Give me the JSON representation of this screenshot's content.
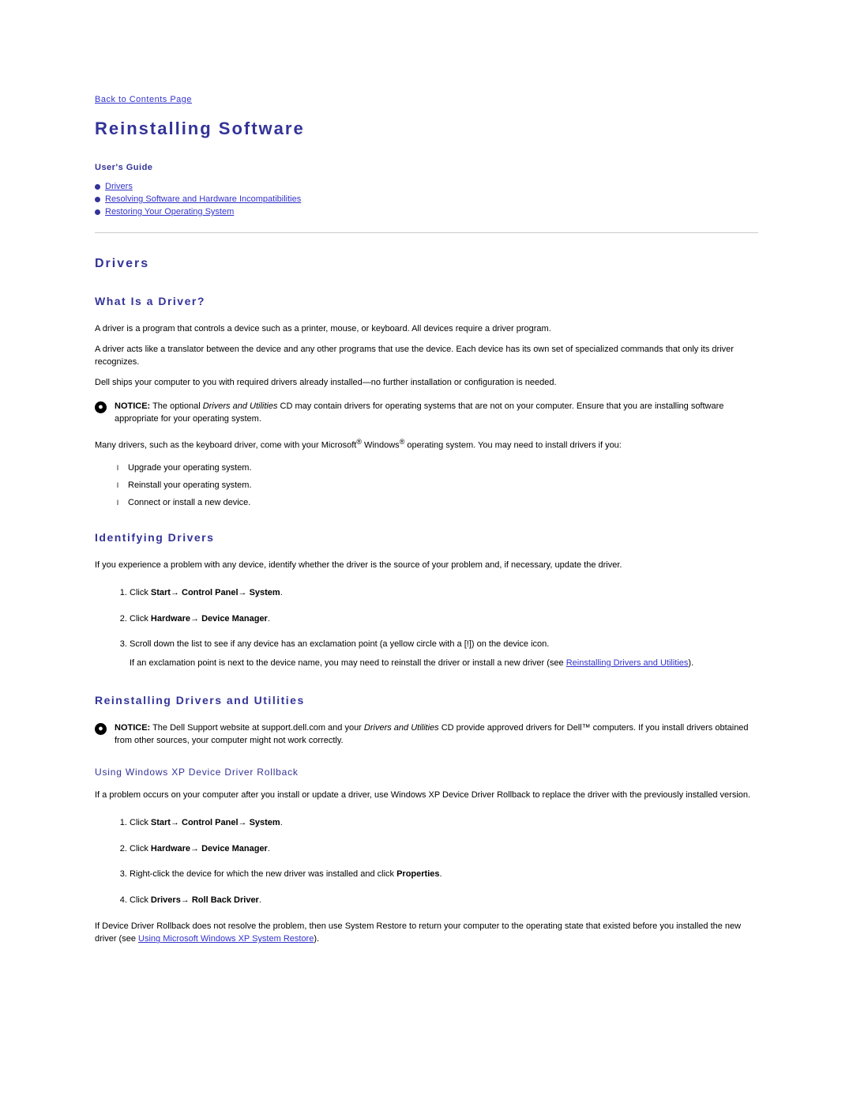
{
  "back_link": "Back to Contents Page",
  "title": "Reinstalling Software",
  "guide_label": "User's Guide",
  "toc": {
    "item1": "Drivers",
    "item2": "Resolving Software and Hardware Incompatibilities",
    "item3": "Restoring Your Operating System"
  },
  "drivers": {
    "heading": "Drivers",
    "what_is": {
      "heading": "What Is a Driver?",
      "p1": "A driver is a program that controls a device such as a printer, mouse, or keyboard. All devices require a driver program.",
      "p2": "A driver acts like a translator between the device and any other programs that use the device. Each device has its own set of specialized commands that only its driver recognizes.",
      "p3": "Dell ships your computer to you with required drivers already installed—no further installation or configuration is needed.",
      "notice_label": "NOTICE:",
      "notice_pre": " The optional ",
      "notice_italic": "Drivers and Utilities",
      "notice_post": " CD may contain drivers for operating systems that are not on your computer. Ensure that you are installing software appropriate for your operating system.",
      "p4_pre": "Many drivers, such as the keyboard driver, come with your Microsoft",
      "p4_mid": " Windows",
      "p4_post": " operating system. You may need to install drivers if you:",
      "l1": "Upgrade your operating system.",
      "l2": "Reinstall your operating system.",
      "l3": "Connect or install a new device."
    },
    "identifying": {
      "heading": "Identifying Drivers",
      "p1": "If you experience a problem with any device, identify whether the driver is the source of your problem and, if necessary, update the driver.",
      "s1_pre": "Click ",
      "s1_bold": "Start→ Control Panel→ System",
      "s1_post": ".",
      "s2_pre": "Click ",
      "s2_bold": "Hardware→ Device Manager",
      "s2_post": ".",
      "s3": "Scroll down the list to see if any device has an exclamation point (a yellow circle with a [!]) on the device icon.",
      "s3b_pre": "If an exclamation point is next to the device name, you may need to reinstall the driver or install a new driver (see ",
      "s3b_link": "Reinstalling Drivers and Utilities",
      "s3b_post": ")."
    },
    "reinstalling": {
      "heading": "Reinstalling Drivers and Utilities",
      "notice_label": "NOTICE:",
      "notice_pre": " The Dell Support website at support.dell.com and your ",
      "notice_italic": "Drivers and Utilities",
      "notice_post": " CD provide approved drivers for Dell™ computers. If you install drivers obtained from other sources, your computer might not work correctly.",
      "rollback": {
        "heading": "Using Windows XP Device Driver Rollback",
        "p1": "If a problem occurs on your computer after you install or update a driver, use Windows XP Device Driver Rollback to replace the driver with the previously installed version.",
        "s1_pre": "Click ",
        "s1_bold": "Start→ Control Panel→ System",
        "s1_post": ".",
        "s2_pre": "Click ",
        "s2_bold": "Hardware→ Device Manager",
        "s2_post": ".",
        "s3_pre": "Right-click the device for which the new driver was installed and click ",
        "s3_bold": "Properties",
        "s3_post": ".",
        "s4_pre": "Click ",
        "s4_bold": "Drivers→ Roll Back Driver",
        "s4_post": ".",
        "p2_pre": "If Device Driver Rollback does not resolve the problem, then use System Restore to return your computer to the operating state that existed before you installed the new driver (see ",
        "p2_link": "Using Microsoft Windows XP System Restore",
        "p2_post": ")."
      }
    }
  }
}
